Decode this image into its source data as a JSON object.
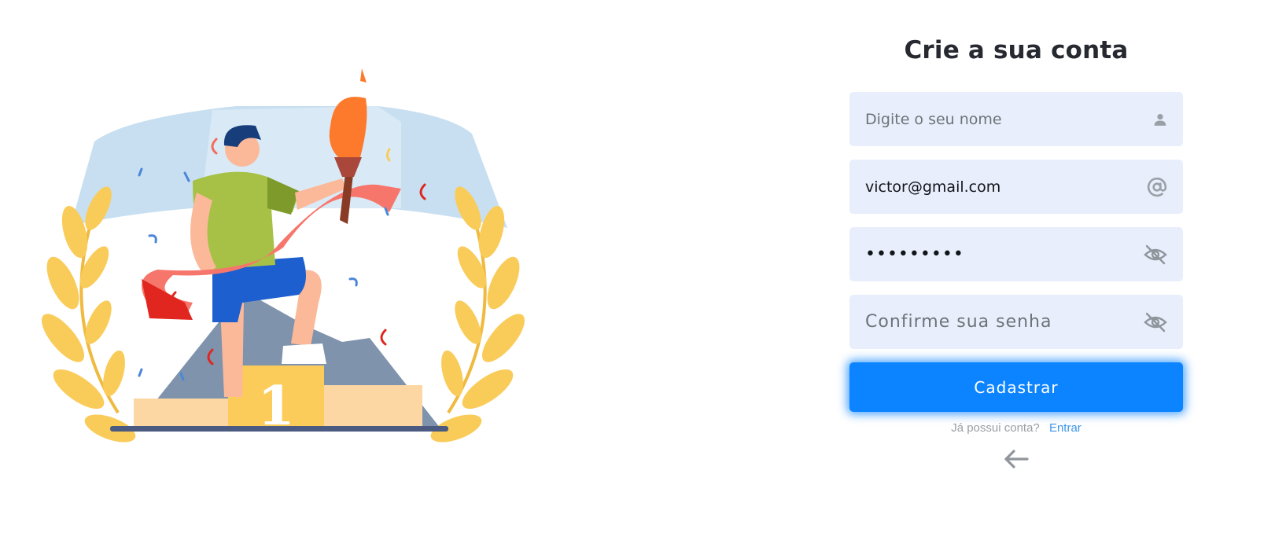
{
  "form": {
    "title": "Crie a sua conta",
    "name_field": {
      "placeholder": "Digite o seu nome",
      "value": "",
      "icon": "user-icon"
    },
    "email_field": {
      "placeholder": "",
      "value": "victor@gmail.com",
      "icon": "at-sign-icon"
    },
    "password_field": {
      "placeholder": "",
      "value": "123456789",
      "icon": "eye-off-icon"
    },
    "confirm_field": {
      "placeholder": "Confirme sua senha",
      "value": "",
      "icon": "eye-off-icon"
    },
    "submit_label": "Cadastrar",
    "login_prompt": "Já possui conta?",
    "login_link": "Entrar",
    "back_icon": "arrow-left-icon"
  },
  "illustration": {
    "podium_label": "1"
  },
  "colors": {
    "primary": "#0d84ff",
    "input_bg": "#e8eefb",
    "link": "#3c95e8",
    "title": "#262a30",
    "icon_gray": "#9aa0a6"
  }
}
